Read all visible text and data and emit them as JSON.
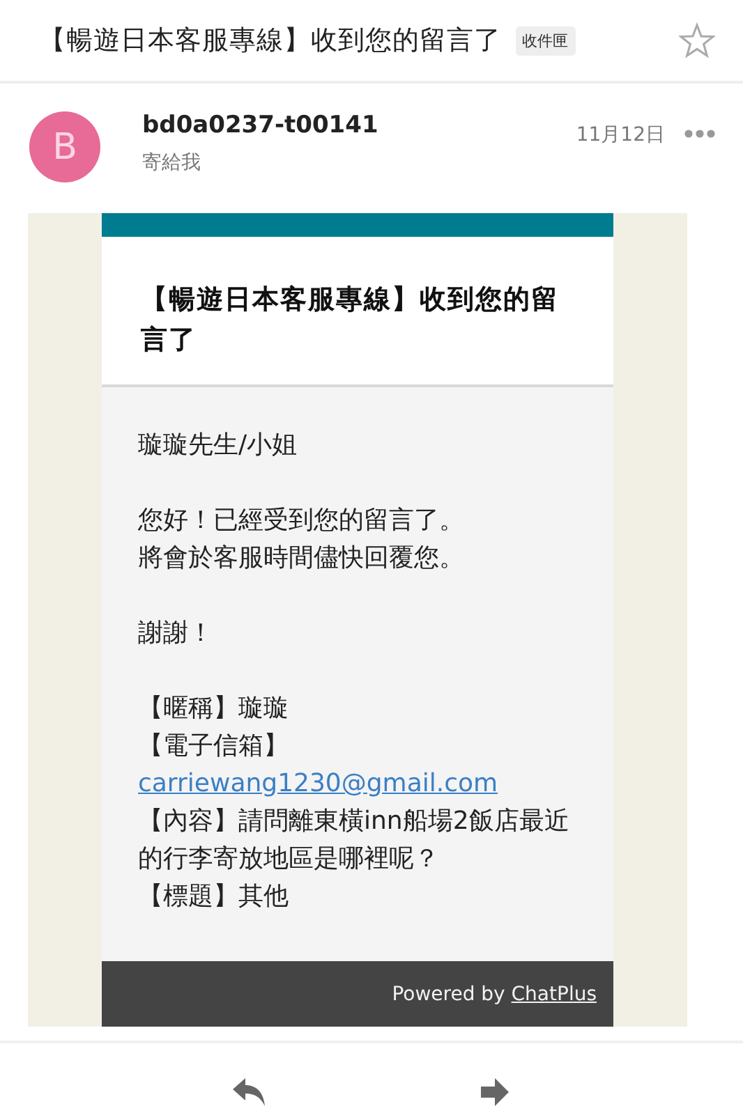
{
  "subject": {
    "title": "【暢遊日本客服專線】收到您的留言了",
    "label": "收件匣",
    "starred": false
  },
  "sender": {
    "avatar_letter": "B",
    "name": "bd0a0237-t00141",
    "recipient": "寄給我",
    "date": "11月12日"
  },
  "message": {
    "title": "【暢遊日本客服專線】收到您的留言了",
    "paragraphs": [
      [
        "璇璇先生/小姐"
      ],
      [
        "您好！已經受到您的留言了。",
        "將會於客服時間儘快回覆您。"
      ],
      [
        "謝謝！"
      ]
    ],
    "fields": [
      {
        "kind": "text",
        "label": "【暱稱】",
        "value": "璇璇"
      },
      {
        "kind": "link",
        "label": "【電子信箱】",
        "value": "carriewang1230@gmail.com"
      },
      {
        "kind": "text",
        "label": "【內容】",
        "value": "請問離東橫inn船場2飯店最近的行李寄放地區是哪裡呢？"
      },
      {
        "kind": "text",
        "label": "【標題】",
        "value": "其他"
      }
    ],
    "footer": {
      "text": "Powered by",
      "link": "ChatPlus"
    }
  }
}
